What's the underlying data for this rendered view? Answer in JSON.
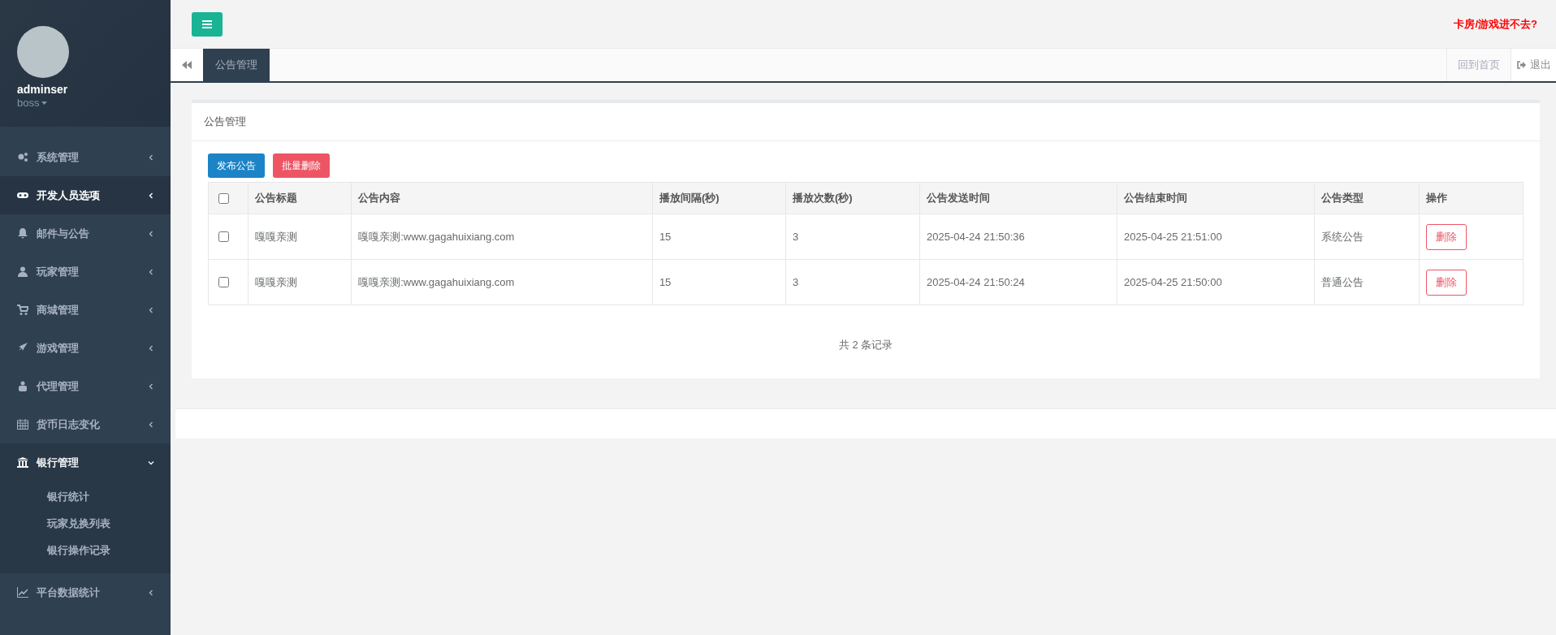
{
  "profile": {
    "name": "adminser",
    "role": "boss"
  },
  "menu": [
    {
      "label": "系统管理",
      "selected": false,
      "expanded": false
    },
    {
      "label": "开发人员选项",
      "selected": true,
      "expanded": false
    },
    {
      "label": "邮件与公告",
      "selected": false,
      "expanded": false
    },
    {
      "label": "玩家管理",
      "selected": false,
      "expanded": false
    },
    {
      "label": "商城管理",
      "selected": false,
      "expanded": false
    },
    {
      "label": "游戏管理",
      "selected": false,
      "expanded": false
    },
    {
      "label": "代理管理",
      "selected": false,
      "expanded": false
    },
    {
      "label": "货币日志变化",
      "selected": false,
      "expanded": false
    },
    {
      "label": "银行管理",
      "selected": false,
      "expanded": true,
      "children": [
        {
          "label": "银行统计"
        },
        {
          "label": "玩家兑换列表"
        },
        {
          "label": "银行操作记录"
        }
      ]
    },
    {
      "label": "平台数据统计",
      "selected": false,
      "expanded": false
    }
  ],
  "header": {
    "alert_link": "卡房/游戏进不去?"
  },
  "tabs": [
    {
      "label": "公告管理",
      "selected": true
    }
  ],
  "tab_actions": {
    "home": "回到首页",
    "logout": "退出"
  },
  "panel": {
    "title": "公告管理",
    "buttons": [
      {
        "label": "发布公告",
        "kind": "primary"
      },
      {
        "label": "批量删除",
        "kind": "danger"
      }
    ],
    "table": {
      "select_all_checked": false,
      "columns": [
        "公告标题",
        "公告内容",
        "播放间隔(秒)",
        "播放次数(秒)",
        "公告发送时间",
        "公告结束时间",
        "公告类型",
        "操作"
      ],
      "rows": [
        {
          "checked": false,
          "cells": [
            "嘎嘎亲测",
            "嘎嘎亲测:www.gagahuixiang.com",
            "15",
            "3",
            "2025-04-24 21:50:36",
            "2025-04-25 21:51:00",
            "系统公告"
          ],
          "action": "删除"
        },
        {
          "checked": false,
          "cells": [
            "嘎嘎亲测",
            "嘎嘎亲测:www.gagahuixiang.com",
            "15",
            "3",
            "2025-04-24 21:50:24",
            "2025-04-25 21:50:00",
            "普通公告"
          ],
          "action": "删除"
        }
      ]
    },
    "footer": "共 2 条记录"
  }
}
